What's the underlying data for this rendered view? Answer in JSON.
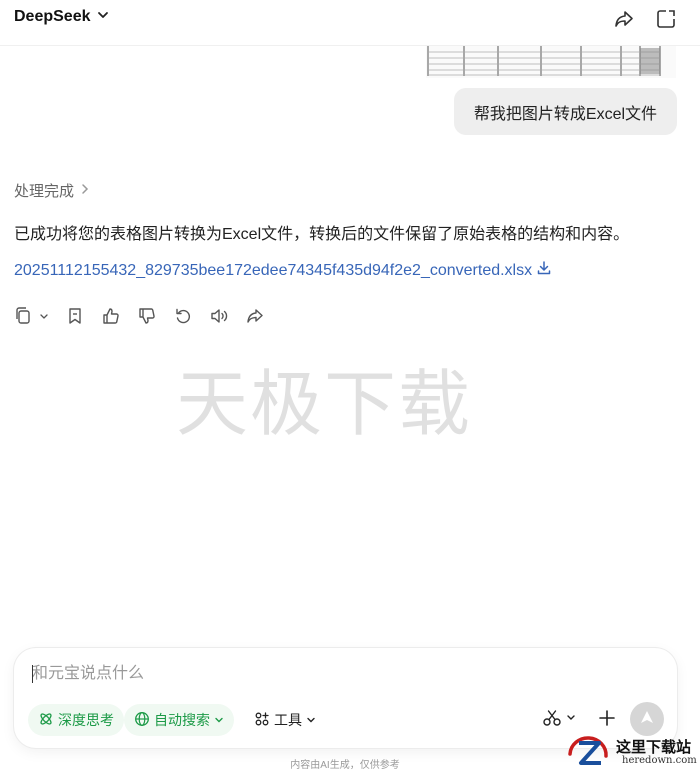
{
  "header": {
    "model_name": "DeepSeek"
  },
  "chat": {
    "user_message": "帮我把图片转成Excel文件",
    "status_text": "处理完成",
    "answer_text": "已成功将您的表格图片转换为Excel文件，转换后的文件保留了原始表格的结构和内容。",
    "file_link": "20251112155432_829735bee172edee74345f435d94f2e2_converted.xlsx"
  },
  "watermark": "天极下载",
  "composer": {
    "placeholder": "和元宝说点什么",
    "deep_think_label": "深度思考",
    "auto_search_label": "自动搜索",
    "tools_label": "工具"
  },
  "disclaimer": "内容由AI生成，仅供参考",
  "logo": {
    "text": "这里下载站",
    "url": "heredown.com"
  },
  "colors": {
    "accent_green": "#1c9a47",
    "link_blue": "#3866b8"
  }
}
